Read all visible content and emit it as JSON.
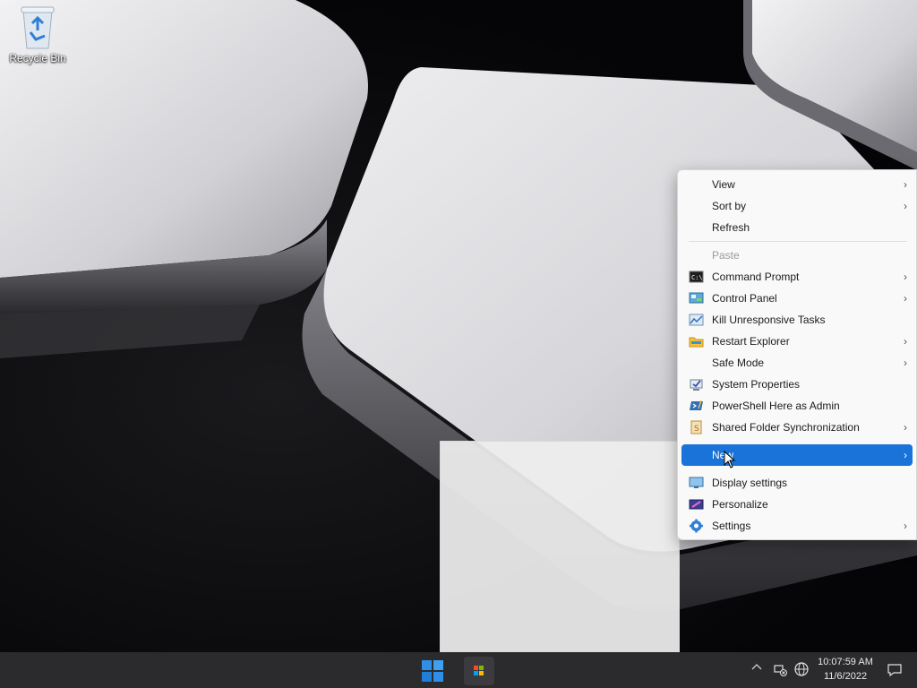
{
  "desktop": {
    "icons": [
      {
        "label": "Recycle Bin",
        "icon": "recycle-bin-icon"
      }
    ]
  },
  "context_menu": {
    "items": [
      {
        "label": "View",
        "submenu": true
      },
      {
        "label": "Sort by",
        "submenu": true
      },
      {
        "label": "Refresh",
        "submenu": false
      },
      {
        "label": "Paste",
        "disabled": true
      },
      {
        "label": "Command Prompt",
        "icon": "command-prompt-icon",
        "submenu": true
      },
      {
        "label": "Control Panel",
        "icon": "control-panel-icon",
        "submenu": true
      },
      {
        "label": "Kill Unresponsive Tasks",
        "icon": "kill-tasks-icon",
        "submenu": false
      },
      {
        "label": "Restart Explorer",
        "icon": "folder-icon",
        "submenu": true
      },
      {
        "label": "Safe Mode",
        "submenu": true
      },
      {
        "label": "System Properties",
        "icon": "system-properties-icon",
        "submenu": false
      },
      {
        "label": "PowerShell Here as Admin",
        "icon": "powershell-icon",
        "submenu": false
      },
      {
        "label": "Shared Folder Synchronization",
        "icon": "sync-icon",
        "submenu": true
      },
      {
        "label": "New",
        "submenu": true,
        "highlighted": true
      },
      {
        "label": "Display settings",
        "icon": "display-icon",
        "submenu": false
      },
      {
        "label": "Personalize",
        "icon": "personalize-icon",
        "submenu": false
      },
      {
        "label": "Settings",
        "icon": "gear-icon",
        "submenu": true
      }
    ],
    "arrow_glyph": "›"
  },
  "taskbar": {
    "pinned": [
      {
        "name": "start",
        "icon": "windows-logo-icon"
      },
      {
        "name": "store",
        "icon": "store-icon"
      }
    ],
    "tray": {
      "clock_time": "10:07:59 AM",
      "clock_date": "11/6/2022"
    }
  },
  "colors": {
    "highlight": "#1a73d8",
    "taskbar": "#2b2b2e",
    "menu_bg": "#f9f9f9"
  }
}
